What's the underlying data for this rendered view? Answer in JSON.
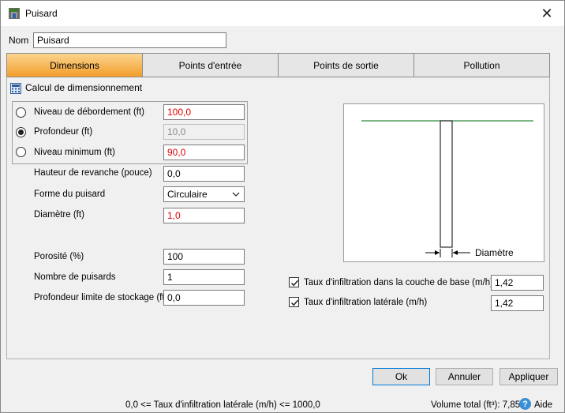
{
  "window": {
    "title": "Puisard",
    "close_symbol": "✕"
  },
  "nom": {
    "label": "Nom",
    "value": "Puisard"
  },
  "tabs": [
    {
      "label": "Dimensions",
      "active": true
    },
    {
      "label": "Points d'entrée",
      "active": false
    },
    {
      "label": "Points de sortie",
      "active": false
    },
    {
      "label": "Pollution",
      "active": false
    }
  ],
  "calc": {
    "title": "Calcul de dimensionnement",
    "niveau_debordement": {
      "label": "Niveau de débordement (ft)",
      "value": "100,0",
      "selected": false
    },
    "profondeur": {
      "label": "Profondeur (ft)",
      "value": "10,0",
      "selected": true
    },
    "niveau_minimum": {
      "label": "Niveau minimum (ft)",
      "value": "90,0",
      "selected": false
    }
  },
  "fields": {
    "hauteur_revanche": {
      "label": "Hauteur de revanche (pouce)",
      "value": "0,0"
    },
    "forme_puisard": {
      "label": "Forme du puisard",
      "value": "Circulaire"
    },
    "diametre": {
      "label": "Diamètre (ft)",
      "value": "1,0"
    },
    "porosite": {
      "label": "Porosité (%)",
      "value": "100"
    },
    "nombre_puisards": {
      "label": "Nombre de puisards",
      "value": "1"
    },
    "profondeur_limite": {
      "label": "Profondeur limite de stockage (ft)",
      "value": "0,0"
    }
  },
  "diagram": {
    "diameter_label": "Diamètre"
  },
  "infiltration": {
    "base": {
      "label": "Taux d'infiltration dans la couche de base (m/h)",
      "value": "1,42",
      "checked": true
    },
    "laterale": {
      "label": "Taux d'infiltration latérale (m/h)",
      "value": "1,42",
      "checked": true
    }
  },
  "buttons": {
    "ok": "Ok",
    "annuler": "Annuler",
    "appliquer": "Appliquer"
  },
  "status": {
    "range_text": "0,0 <= Taux d'infiltration latérale (m/h) <= 1000,0",
    "volume_text": "Volume total (ft³): 7,854",
    "help_symbol": "?",
    "help_label": "Aide"
  },
  "colors": {
    "active_tab_top": "#fbd48f",
    "active_tab_bottom": "#f29e2a",
    "error_text": "#e00000",
    "ground_line": "#2e8b3a"
  },
  "icons": {
    "app": "sump-icon",
    "calc": "calculator-icon",
    "close": "close-icon",
    "help": "help-icon"
  }
}
